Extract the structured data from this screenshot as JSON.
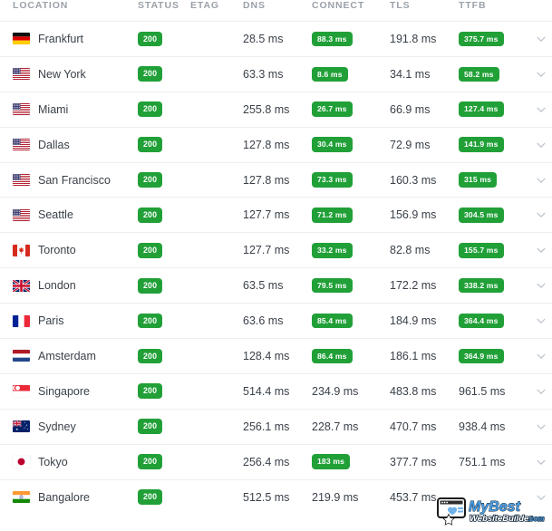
{
  "table": {
    "columns": [
      {
        "key": "location",
        "label": "LOCATION"
      },
      {
        "key": "status",
        "label": "STATUS"
      },
      {
        "key": "etag",
        "label": "ETAG"
      },
      {
        "key": "dns",
        "label": "DNS"
      },
      {
        "key": "connect",
        "label": "CONNECT"
      },
      {
        "key": "tls",
        "label": "TLS"
      },
      {
        "key": "ttfb",
        "label": "TTFB"
      }
    ],
    "rows": [
      {
        "location": "Frankfurt",
        "flag": "de",
        "status": "200",
        "status_badge": true,
        "etag": "",
        "dns": "28.5 ms",
        "dns_badge": false,
        "connect": "88.3 ms",
        "connect_badge": true,
        "tls": "191.8 ms",
        "tls_badge": false,
        "ttfb": "375.7 ms",
        "ttfb_badge": true
      },
      {
        "location": "New York",
        "flag": "us",
        "status": "200",
        "status_badge": true,
        "etag": "",
        "dns": "63.3 ms",
        "dns_badge": false,
        "connect": "8.6 ms",
        "connect_badge": true,
        "tls": "34.1 ms",
        "tls_badge": false,
        "ttfb": "58.2 ms",
        "ttfb_badge": true
      },
      {
        "location": "Miami",
        "flag": "us",
        "status": "200",
        "status_badge": true,
        "etag": "",
        "dns": "255.8 ms",
        "dns_badge": false,
        "connect": "26.7 ms",
        "connect_badge": true,
        "tls": "66.9 ms",
        "tls_badge": false,
        "ttfb": "127.4 ms",
        "ttfb_badge": true
      },
      {
        "location": "Dallas",
        "flag": "us",
        "status": "200",
        "status_badge": true,
        "etag": "",
        "dns": "127.8 ms",
        "dns_badge": false,
        "connect": "30.4 ms",
        "connect_badge": true,
        "tls": "72.9 ms",
        "tls_badge": false,
        "ttfb": "141.9 ms",
        "ttfb_badge": true
      },
      {
        "location": "San Francisco",
        "flag": "us",
        "status": "200",
        "status_badge": true,
        "etag": "",
        "dns": "127.8 ms",
        "dns_badge": false,
        "connect": "73.3 ms",
        "connect_badge": true,
        "tls": "160.3 ms",
        "tls_badge": false,
        "ttfb": "315 ms",
        "ttfb_badge": true
      },
      {
        "location": "Seattle",
        "flag": "us",
        "status": "200",
        "status_badge": true,
        "etag": "",
        "dns": "127.7 ms",
        "dns_badge": false,
        "connect": "71.2 ms",
        "connect_badge": true,
        "tls": "156.9 ms",
        "tls_badge": false,
        "ttfb": "304.5 ms",
        "ttfb_badge": true
      },
      {
        "location": "Toronto",
        "flag": "ca",
        "status": "200",
        "status_badge": true,
        "etag": "",
        "dns": "127.7 ms",
        "dns_badge": false,
        "connect": "33.2 ms",
        "connect_badge": true,
        "tls": "82.8 ms",
        "tls_badge": false,
        "ttfb": "155.7 ms",
        "ttfb_badge": true
      },
      {
        "location": "London",
        "flag": "gb",
        "status": "200",
        "status_badge": true,
        "etag": "",
        "dns": "63.5 ms",
        "dns_badge": false,
        "connect": "79.5 ms",
        "connect_badge": true,
        "tls": "172.2 ms",
        "tls_badge": false,
        "ttfb": "338.2 ms",
        "ttfb_badge": true
      },
      {
        "location": "Paris",
        "flag": "fr",
        "status": "200",
        "status_badge": true,
        "etag": "",
        "dns": "63.6 ms",
        "dns_badge": false,
        "connect": "85.4 ms",
        "connect_badge": true,
        "tls": "184.9 ms",
        "tls_badge": false,
        "ttfb": "364.4 ms",
        "ttfb_badge": true
      },
      {
        "location": "Amsterdam",
        "flag": "nl",
        "status": "200",
        "status_badge": true,
        "etag": "",
        "dns": "128.4 ms",
        "dns_badge": false,
        "connect": "86.4 ms",
        "connect_badge": true,
        "tls": "186.1 ms",
        "tls_badge": false,
        "ttfb": "364.9 ms",
        "ttfb_badge": true
      },
      {
        "location": "Singapore",
        "flag": "sg",
        "status": "200",
        "status_badge": true,
        "etag": "",
        "dns": "514.4 ms",
        "dns_badge": false,
        "connect": "234.9 ms",
        "connect_badge": false,
        "tls": "483.8 ms",
        "tls_badge": false,
        "ttfb": "961.5 ms",
        "ttfb_badge": false
      },
      {
        "location": "Sydney",
        "flag": "au",
        "status": "200",
        "status_badge": true,
        "etag": "",
        "dns": "256.1 ms",
        "dns_badge": false,
        "connect": "228.7 ms",
        "connect_badge": false,
        "tls": "470.7 ms",
        "tls_badge": false,
        "ttfb": "938.4 ms",
        "ttfb_badge": false
      },
      {
        "location": "Tokyo",
        "flag": "jp",
        "status": "200",
        "status_badge": true,
        "etag": "",
        "dns": "256.4 ms",
        "dns_badge": false,
        "connect": "183 ms",
        "connect_badge": true,
        "tls": "377.7 ms",
        "tls_badge": false,
        "ttfb": "751.1 ms",
        "ttfb_badge": false
      },
      {
        "location": "Bangalore",
        "flag": "in",
        "status": "200",
        "status_badge": true,
        "etag": "",
        "dns": "512.5 ms",
        "dns_badge": false,
        "connect": "219.9 ms",
        "connect_badge": false,
        "tls": "453.7 ms",
        "tls_badge": false,
        "ttfb": "",
        "ttfb_badge": false
      }
    ],
    "expand_icon": "chevron-down-icon"
  },
  "watermark": {
    "line1": "MyBest",
    "line2": "WebsiteBuilder",
    "suffix": ".com"
  },
  "colors": {
    "badge_green": "#21a038",
    "header_text": "#9aa1a9",
    "body_text": "#3a4149",
    "row_border": "#eceef0"
  }
}
